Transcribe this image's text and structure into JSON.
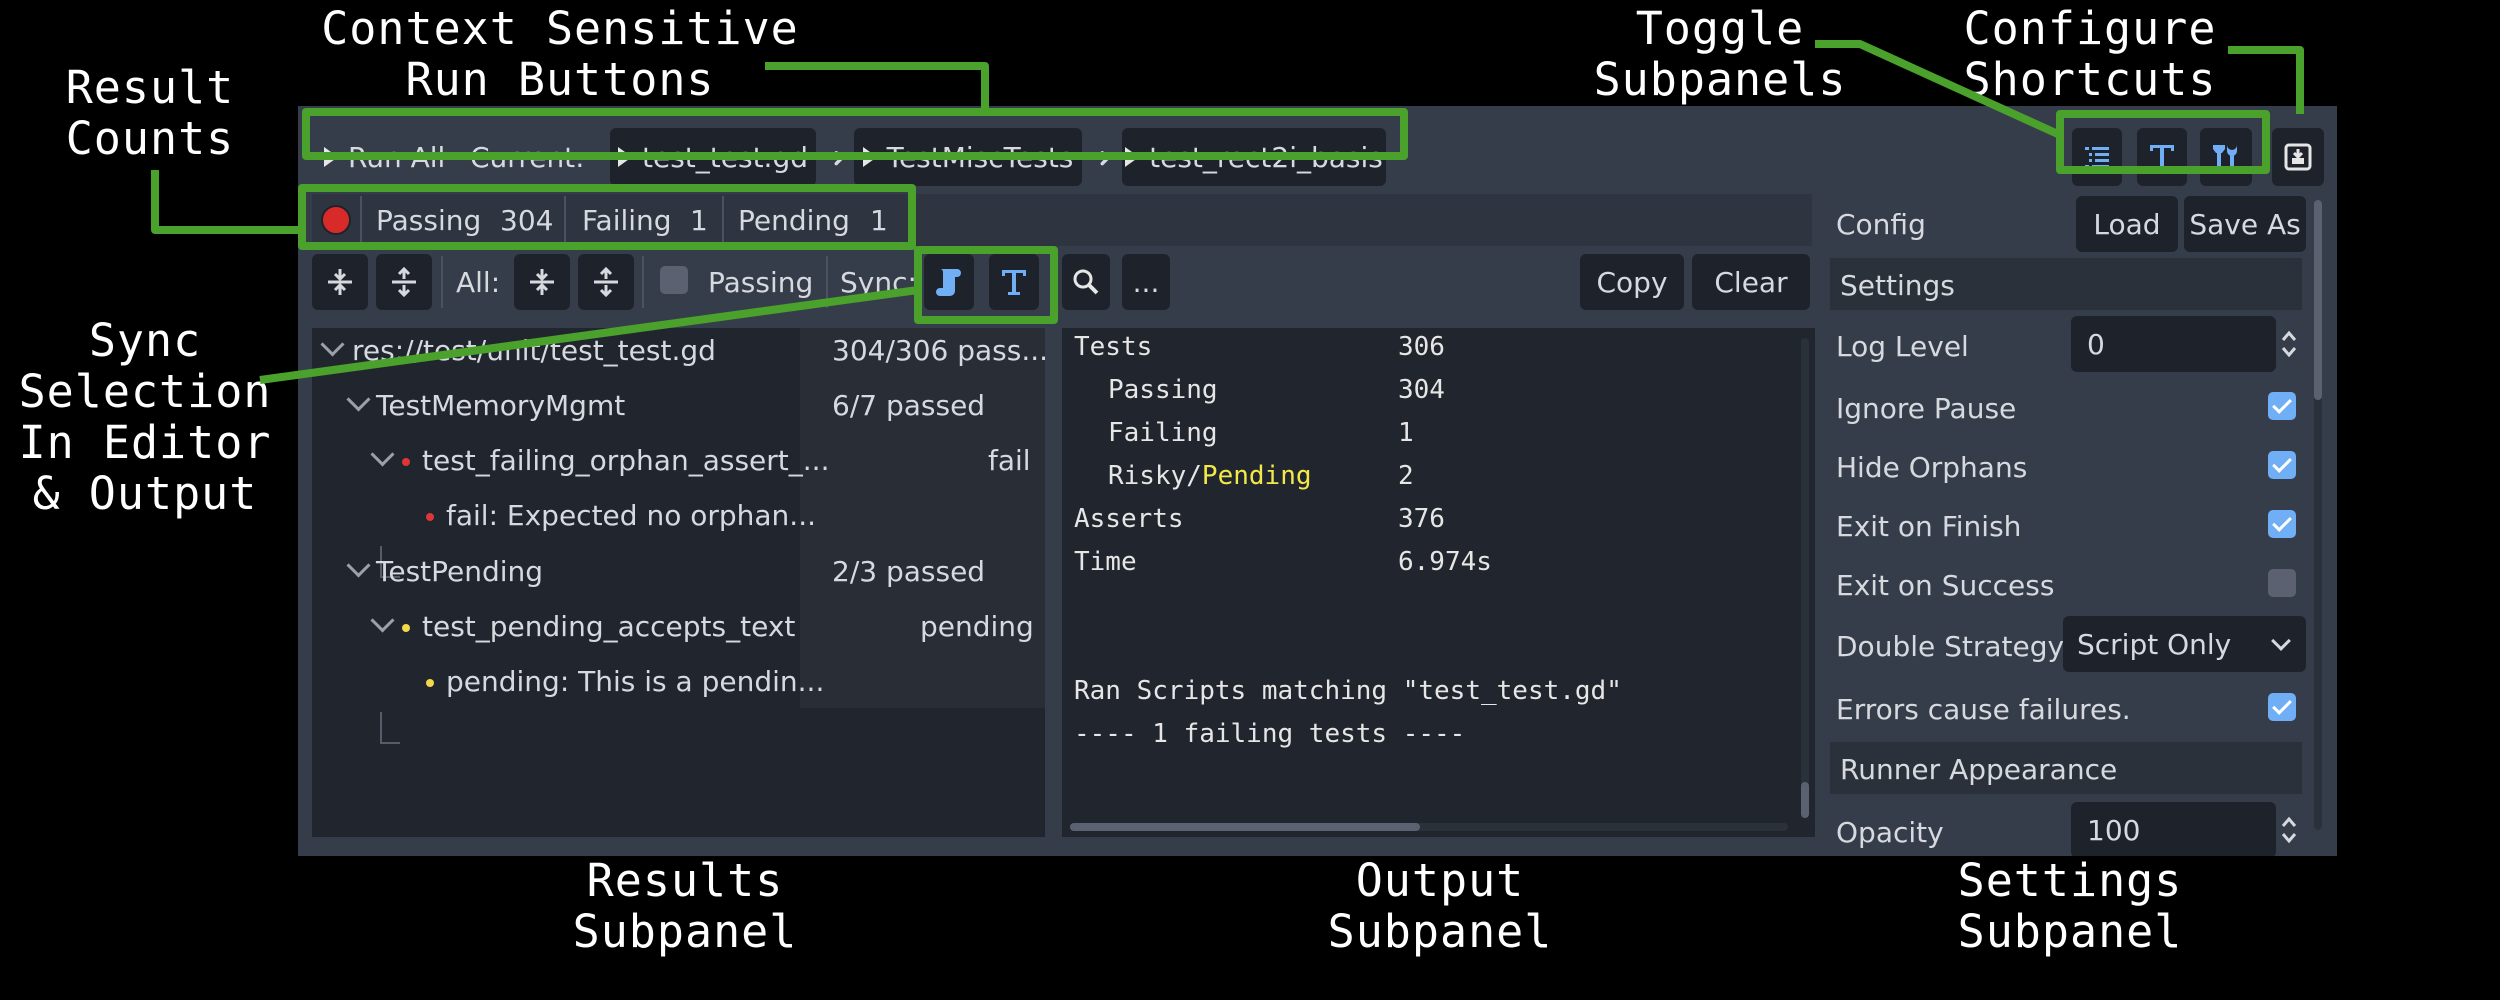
{
  "annotations": {
    "result_counts": "Result\nCounts",
    "run_buttons": "Context Sensitive\nRun Buttons",
    "toggle_subpanels": "Toggle\nSubpanels",
    "configure_shortcuts": "Configure\nShortcuts",
    "sync_selection": "Sync\nSelection\nIn Editor\n& Output",
    "results_subpanel": "Results\nSubpanel",
    "output_subpanel": "Output\nSubpanel",
    "settings_subpanel": "Settings\nSubpanel"
  },
  "toolbar": {
    "run_all": "Run All",
    "current_label": "Current:",
    "crumbs": [
      "test_test.gd",
      "TestMiscTests",
      "test_rect2i_basis"
    ],
    "arrow": "➜"
  },
  "counts": {
    "passing_label": "Passing",
    "passing": "304",
    "failing_label": "Failing",
    "failing": "1",
    "pending_label": "Pending",
    "pending": "1"
  },
  "results_toolbar": {
    "all_label": "All:",
    "passing_label": "Passing",
    "sync_label": "Sync:",
    "more": "..."
  },
  "output_toolbar": {
    "copy": "Copy",
    "clear": "Clear"
  },
  "tree": [
    {
      "label": "res://test/unit/test_test.gd",
      "status": "304/306 pass..."
    },
    {
      "label": "TestMemoryMgmt",
      "status": "6/7 passed"
    },
    {
      "label": "test_failing_orphan_assert_...",
      "status": "fail"
    },
    {
      "label": "fail:  Expected no orphan...",
      "status": ""
    },
    {
      "label": "TestPending",
      "status": "2/3 passed"
    },
    {
      "label": "test_pending_accepts_text",
      "status": "pending"
    },
    {
      "label": "pending:  This is a pendin...",
      "status": ""
    }
  ],
  "output": {
    "tests_label": "Tests",
    "tests": "306",
    "passing_label": "Passing",
    "passing": "304",
    "failing_label": "Failing",
    "failing": "1",
    "risky_label": "Risky/",
    "pending_word": "Pending",
    "risky": "2",
    "asserts_label": "Asserts",
    "asserts": "376",
    "time_label": "Time",
    "time": "6.974s",
    "ran_scripts": "Ran Scripts matching \"test_test.gd\"",
    "failing_tests": "---- 1 failing tests ----"
  },
  "settings": {
    "config_label": "Config",
    "load": "Load",
    "save_as": "Save As",
    "settings_header": "Settings",
    "log_level_label": "Log Level",
    "log_level": "0",
    "ignore_pause": "Ignore Pause",
    "hide_orphans": "Hide Orphans",
    "exit_on_finish": "Exit on Finish",
    "exit_on_success": "Exit on Success",
    "double_strategy_label": "Double Strategy",
    "double_strategy": "Script Only",
    "errors_cause_failures": "Errors cause failures.",
    "runner_appearance": "Runner Appearance",
    "opacity_label": "Opacity",
    "opacity": "100"
  },
  "colors": {
    "annotation_green": "#4aa12b",
    "panel_bg": "#363d4a",
    "button_bg": "#1e232b",
    "fail_red": "#e03535",
    "pending_yellow": "#f2d84a",
    "accent_blue": "#70aef5"
  }
}
